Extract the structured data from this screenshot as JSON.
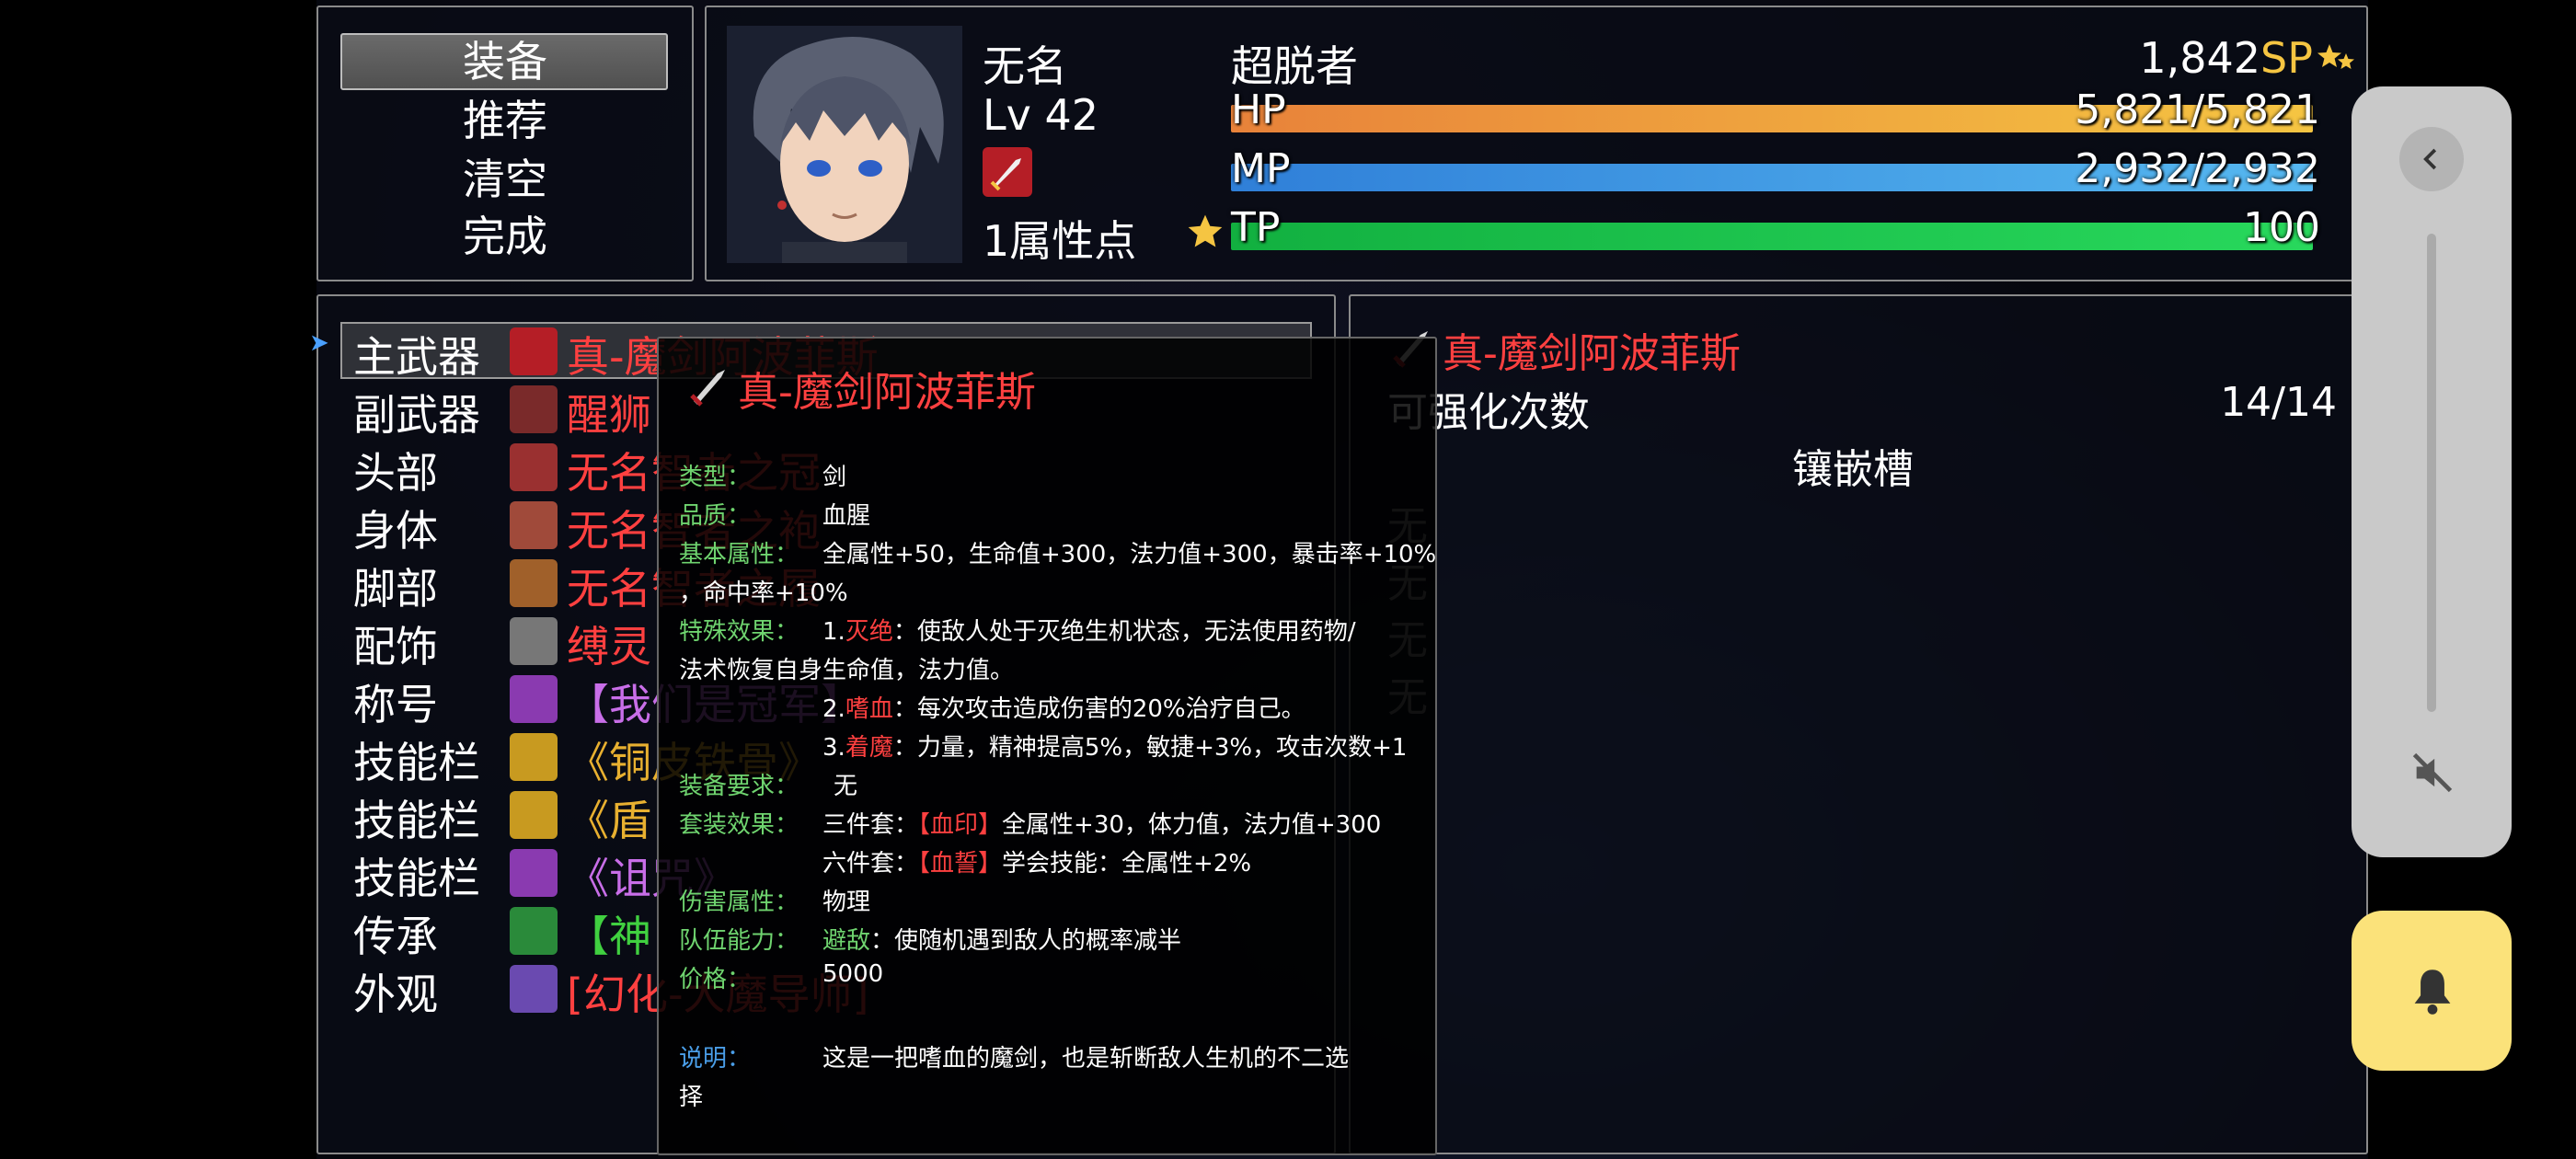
{
  "menu": {
    "items": [
      "装备",
      "推荐",
      "清空",
      "完成"
    ],
    "selected_index": 0
  },
  "actor": {
    "name": "无名",
    "level": "Lv 42",
    "class": "超脱者",
    "attr_points": "1属性点",
    "sp_value": "1,842",
    "sp_unit": "SP",
    "hp_label": "HP",
    "hp_value": "5,821/5,821",
    "hp_ratio": 1.0,
    "mp_label": "MP",
    "mp_value": "2,932/2,932",
    "mp_ratio": 1.0,
    "tp_label": "TP",
    "tp_value": "100",
    "tp_ratio": 1.0,
    "colors": {
      "hp": "#f2a43c",
      "mp": "#3d9be6",
      "tp": "#1fcf4e"
    }
  },
  "slots": [
    {
      "label": "主武器",
      "item": "真-魔剑阿波菲斯",
      "color": "#ff4040",
      "icon": "sword-icon"
    },
    {
      "label": "副武器",
      "item": "醒狮",
      "color": "#ff4040",
      "icon": "lion-icon"
    },
    {
      "label": "头部",
      "item": "无名智者之冠",
      "color": "#ff4040",
      "icon": "hat-icon"
    },
    {
      "label": "身体",
      "item": "无名智者之袍",
      "color": "#ff4040",
      "icon": "robe-icon"
    },
    {
      "label": "脚部",
      "item": "无名智者之履",
      "color": "#ff4040",
      "icon": "boots-icon"
    },
    {
      "label": "配饰",
      "item": "缚灵",
      "color": "#ff4040",
      "icon": "amulet-icon"
    },
    {
      "label": "称号",
      "item": "【我们是冠军】",
      "color": "#c86ee8",
      "icon": "title-icon"
    },
    {
      "label": "技能栏",
      "item": "《铜皮铁骨》",
      "color": "#e8b030",
      "icon": "skill-crown-icon"
    },
    {
      "label": "技能栏",
      "item": "《盾",
      "color": "#e8b030",
      "icon": "skill-shield-icon"
    },
    {
      "label": "技能栏",
      "item": "《诅咒》",
      "color": "#c86ee8",
      "icon": "skill-skull-icon"
    },
    {
      "label": "传承",
      "item": "【神",
      "color": "#40d040",
      "icon": "inherit-icon"
    },
    {
      "label": "外观",
      "item": "[幻化-大魔导师]",
      "color": "#ff4040",
      "icon": "mage-icon"
    }
  ],
  "detail": {
    "item_name": "真-魔剑阿波菲斯",
    "enhance_label": "可强化次数",
    "enhance_value": "14/14",
    "socket_title": "镶嵌槽",
    "socket_empty": "无"
  },
  "tooltip": {
    "title": "真-魔剑阿波菲斯",
    "type_key": "类型：",
    "type_val": "剑",
    "quality_key": "品质：",
    "quality_val": "血腥",
    "base_key": "基本属性：",
    "base_val": "全属性+50，生命值+300，法力值+300，暴击率+10%",
    "base_val2": "，命中率+10%",
    "effect_key": "特殊效果：",
    "effect1_num": "1.",
    "effect1_name": "灭绝",
    "effect1_text": "：使敌人处于灭绝生机状态，无法使用药物/",
    "effect1_text2": "法术恢复自身生命值，法力值。",
    "effect2_num": "2.",
    "effect2_name": "嗜血",
    "effect2_text": "：每次攻击造成伤害的20%治疗自己。",
    "effect3_num": "3.",
    "effect3_name": "着魔",
    "effect3_text": "：力量，精神提高5%，敏捷+3%，攻击次数+1",
    "req_key": "装备要求：",
    "req_val": "无",
    "set_key": "套装效果：",
    "set1_prefix": "三件套：",
    "set1_name": "【血印】",
    "set1_text": "全属性+30，体力值，法力值+300",
    "set2_prefix": "六件套：",
    "set2_name": "【血誓】",
    "set2_text": "学会技能：全属性+2%",
    "dmg_key": "伤害属性：",
    "dmg_val": "物理",
    "team_key": "队伍能力：",
    "team_name": "避敌",
    "team_text": "：使随机遇到敌人的概率减半",
    "price_key": "价格：",
    "price_val": "5000",
    "desc_key": "说明：",
    "desc_val": "这是一把嗜血的魔剑，也是斩断敌人生机的不二选",
    "desc_val2": "择"
  },
  "colors": {
    "menu_bg": "#0a0c16",
    "highlight": "#ff4040",
    "green_key": "#6fd46f",
    "sp_color": "#f5c542"
  }
}
